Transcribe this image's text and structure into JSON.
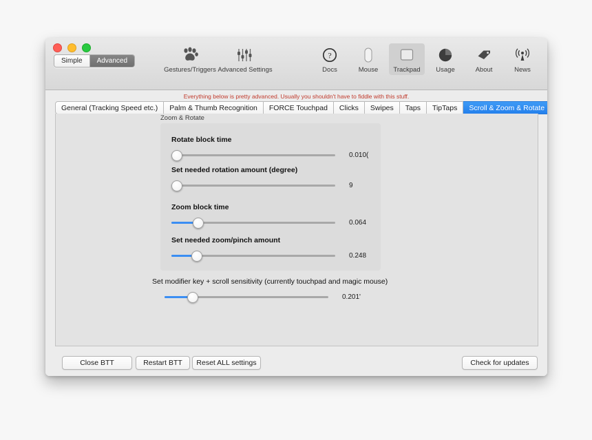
{
  "window": {
    "traffic_lights": [
      "close",
      "minimize",
      "zoom"
    ]
  },
  "mode_switch": {
    "options": [
      "Simple",
      "Advanced"
    ],
    "selected": "Advanced"
  },
  "toolbar_left": [
    {
      "label": "Gestures/Triggers",
      "icon": "paw-icon"
    },
    {
      "label": "Advanced Settings",
      "icon": "sliders-icon"
    }
  ],
  "toolbar_right": [
    {
      "label": "Docs",
      "icon": "question-circle-icon",
      "selected": false
    },
    {
      "label": "Mouse",
      "icon": "mouse-icon",
      "selected": false
    },
    {
      "label": "Trackpad",
      "icon": "trackpad-icon",
      "selected": true
    },
    {
      "label": "Usage",
      "icon": "pie-chart-icon",
      "selected": false
    },
    {
      "label": "About",
      "icon": "tag-icon",
      "selected": false
    },
    {
      "label": "News",
      "icon": "broadcast-icon",
      "selected": false
    }
  ],
  "warning_text": "Everything below is pretty advanced. Usually you shouldn't have to fiddle with this stuff.",
  "tabs": [
    {
      "label": "General (Tracking Speed etc.)",
      "active": false
    },
    {
      "label": "Palm & Thumb Recognition",
      "active": false
    },
    {
      "label": "FORCE Touchpad",
      "active": false
    },
    {
      "label": "Clicks",
      "active": false
    },
    {
      "label": "Swipes",
      "active": false
    },
    {
      "label": "Taps",
      "active": false
    },
    {
      "label": "TipTaps",
      "active": false
    },
    {
      "label": "Scroll & Zoom & Rotate",
      "active": true
    }
  ],
  "group": {
    "title": "Zoom & Rotate",
    "sliders": [
      {
        "label": "Rotate block time",
        "value": "0.010(",
        "percent": 3
      },
      {
        "label": "Set needed rotation amount (degree)",
        "value": "9",
        "percent": 3
      },
      {
        "label": "Zoom block time",
        "value": "0.064",
        "percent": 16
      },
      {
        "label": "Set needed zoom/pinch amount",
        "value": "0.248",
        "percent": 15
      }
    ]
  },
  "standalone_slider": {
    "label": "Set modifier key + scroll sensitivity (currently touchpad and magic mouse)",
    "value": "0.201'",
    "percent": 17
  },
  "bottom_buttons": {
    "close": "Close BTT",
    "restart": "Restart BTT",
    "reset": "Reset ALL settings",
    "updates": "Check for updates"
  },
  "colors": {
    "accent": "#2480ec",
    "warning": "#c0392b",
    "window_bg": "#ececec",
    "panel_bg": "#e3e3e3",
    "group_bg": "#dcdcdc"
  }
}
